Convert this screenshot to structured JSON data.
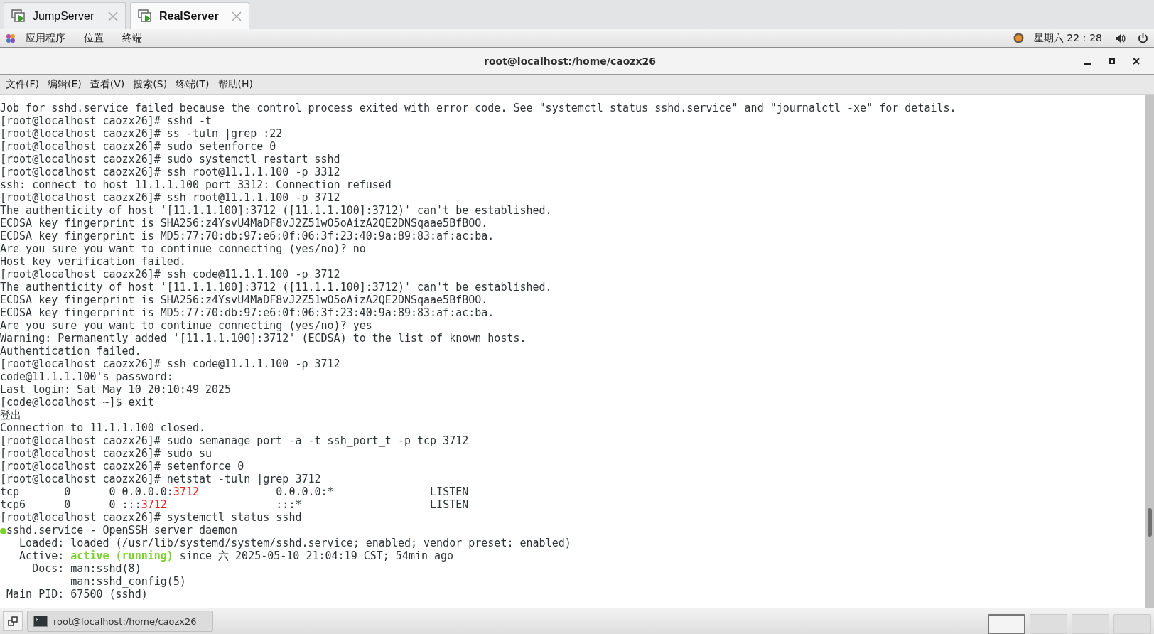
{
  "vm_tabs": [
    {
      "label": "JumpServer",
      "selected": false
    },
    {
      "label": "RealServer",
      "selected": true
    }
  ],
  "top_panel": {
    "menus": [
      "应用程序",
      "位置",
      "终端"
    ],
    "clock": "星期六 22：28"
  },
  "window": {
    "title": "root@localhost:/home/caozx26"
  },
  "menubar": [
    "文件(F)",
    "编辑(E)",
    "查看(V)",
    "搜索(S)",
    "终端(T)",
    "帮助(H)"
  ],
  "terminal": {
    "lines": [
      {
        "text": "Job for sshd.service failed because the control process exited with error code. See \"systemctl status sshd.service\" and \"journalctl -xe\" for details."
      },
      {
        "text": "[root@localhost caozx26]# sshd -t"
      },
      {
        "text": "[root@localhost caozx26]# ss -tuln |grep :22"
      },
      {
        "text": "[root@localhost caozx26]# sudo setenforce 0"
      },
      {
        "text": "[root@localhost caozx26]# sudo systemctl restart sshd"
      },
      {
        "text": "[root@localhost caozx26]# ssh root@11.1.1.100 -p 3312"
      },
      {
        "text": "ssh: connect to host 11.1.1.100 port 3312: Connection refused"
      },
      {
        "text": "[root@localhost caozx26]# ssh root@11.1.1.100 -p 3712"
      },
      {
        "text": "The authenticity of host '[11.1.1.100]:3712 ([11.1.1.100]:3712)' can't be established."
      },
      {
        "text": "ECDSA key fingerprint is SHA256:z4YsvU4MaDF8vJ2Z51wO5oAizA2QE2DNSqaae5BfBOO."
      },
      {
        "text": "ECDSA key fingerprint is MD5:77:70:db:97:e6:0f:06:3f:23:40:9a:89:83:af:ac:ba."
      },
      {
        "text": "Are you sure you want to continue connecting (yes/no)? no"
      },
      {
        "text": "Host key verification failed."
      },
      {
        "text": "[root@localhost caozx26]# ssh code@11.1.1.100 -p 3712"
      },
      {
        "text": "The authenticity of host '[11.1.1.100]:3712 ([11.1.1.100]:3712)' can't be established."
      },
      {
        "text": "ECDSA key fingerprint is SHA256:z4YsvU4MaDF8vJ2Z51wO5oAizA2QE2DNSqaae5BfBOO."
      },
      {
        "text": "ECDSA key fingerprint is MD5:77:70:db:97:e6:0f:06:3f:23:40:9a:89:83:af:ac:ba."
      },
      {
        "text": "Are you sure you want to continue connecting (yes/no)? yes"
      },
      {
        "text": "Warning: Permanently added '[11.1.1.100]:3712' (ECDSA) to the list of known hosts."
      },
      {
        "text": "Authentication failed."
      },
      {
        "text": "[root@localhost caozx26]# ssh code@11.1.1.100 -p 3712"
      },
      {
        "text": "code@11.1.1.100's password:"
      },
      {
        "text": "Last login: Sat May 10 20:10:49 2025"
      },
      {
        "text": "[code@localhost ~]$ exit"
      },
      {
        "text": "登出"
      },
      {
        "text": "Connection to 11.1.1.100 closed."
      },
      {
        "text": "[root@localhost caozx26]# sudo semanage port -a -t ssh_port_t -p tcp 3712"
      },
      {
        "text": "[root@localhost caozx26]# sudo su"
      },
      {
        "text": "[root@localhost caozx26]# setenforce 0"
      },
      {
        "text": "[root@localhost caozx26]# netstat -tuln |grep 3712"
      },
      {
        "segments": [
          {
            "text": "tcp       0      0 0.0.0.0:",
            "kind": "plain"
          },
          {
            "text": "3712",
            "kind": "red"
          },
          {
            "text": "            0.0.0.0:*               LISTEN",
            "kind": "plain"
          }
        ]
      },
      {
        "segments": [
          {
            "text": "tcp6      0      0 :::",
            "kind": "plain"
          },
          {
            "text": "3712",
            "kind": "red"
          },
          {
            "text": "                 :::*                    LISTEN",
            "kind": "plain"
          }
        ]
      },
      {
        "text": "[root@localhost caozx26]# systemctl status sshd"
      },
      {
        "segments": [
          {
            "text": "●",
            "kind": "green"
          },
          {
            "text": "sshd.service - OpenSSH server daemon",
            "kind": "plain"
          }
        ]
      },
      {
        "text": "   Loaded: loaded (/usr/lib/systemd/system/sshd.service; enabled; vendor preset: enabled)"
      },
      {
        "segments": [
          {
            "text": "   Active: ",
            "kind": "plain"
          },
          {
            "text": "active (running)",
            "kind": "green"
          },
          {
            "text": " since 六 2025-05-10 21:04:19 CST; 54min ago",
            "kind": "plain"
          }
        ]
      },
      {
        "text": "     Docs: man:sshd(8)"
      },
      {
        "text": "           man:sshd_config(5)"
      },
      {
        "text": " Main PID: 67500 (sshd)"
      }
    ]
  },
  "taskbar": {
    "task": "root@localhost:/home/caozx26",
    "workspaces": [
      {
        "selected": true
      },
      {
        "selected": false
      },
      {
        "selected": false
      },
      {
        "selected": false
      }
    ]
  }
}
